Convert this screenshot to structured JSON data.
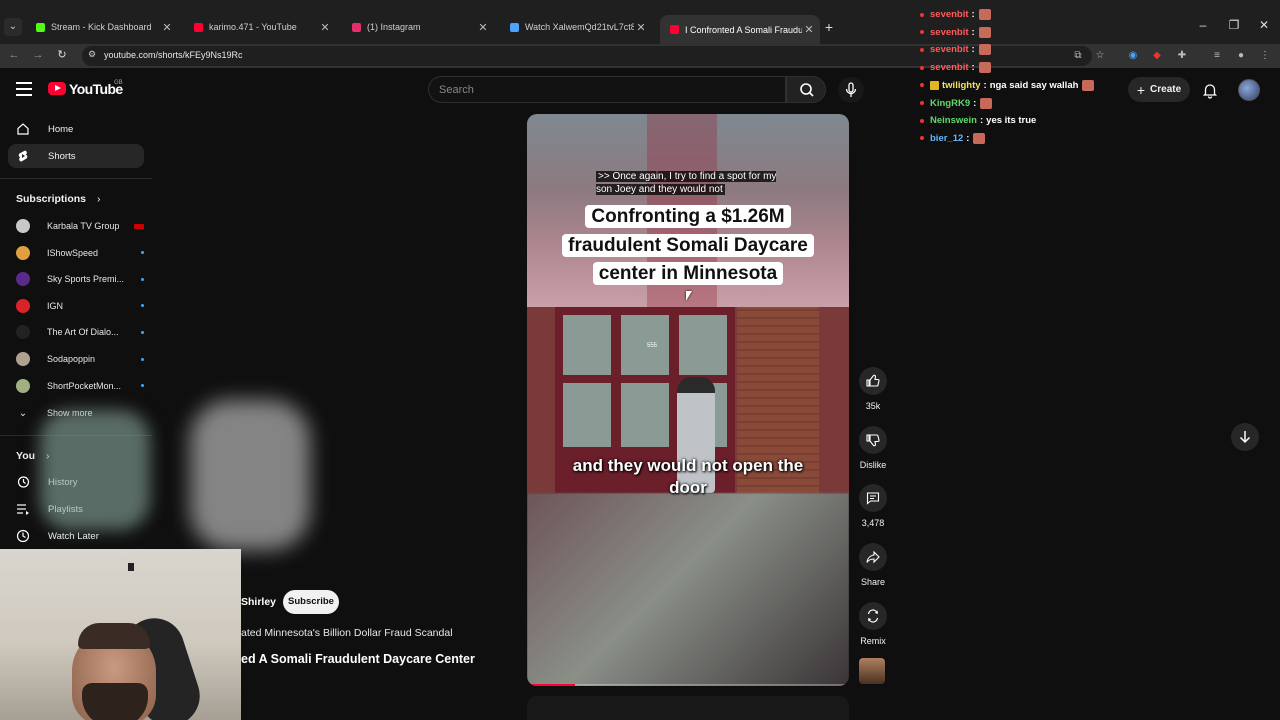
{
  "browser": {
    "tabs": [
      {
        "title": "Stream - Kick Dashboard",
        "color": "#53fc18"
      },
      {
        "title": "karimo.471 - YouTube",
        "color": "#ff0033"
      },
      {
        "title": "(1) Instagram",
        "color": "#e1306c"
      },
      {
        "title": "Watch XalwemQd21tvL7ct8RUt...",
        "color": "#4aa3ff"
      },
      {
        "title": "I Confronted A Somali Fraudule...",
        "color": "#ff0033"
      }
    ],
    "url": "youtube.com/shorts/kFEy9Ns19Rc"
  },
  "masthead": {
    "logo_text": "YouTube",
    "region": "GB",
    "search_placeholder": "Search",
    "create_label": "Create"
  },
  "sidebar": {
    "main": [
      {
        "label": "Home",
        "icon": "home-icon"
      },
      {
        "label": "Shorts",
        "icon": "shorts-icon"
      }
    ],
    "subscriptions_heading": "Subscriptions",
    "channels": [
      {
        "name": "Karbala TV Group",
        "color": "#c8c8c8",
        "live": true
      },
      {
        "name": "IShowSpeed",
        "color": "#e0a040",
        "live": false
      },
      {
        "name": "Sky Sports Premi...",
        "color": "#5a2a8a",
        "live": false
      },
      {
        "name": "IGN",
        "color": "#d8232a",
        "live": false
      },
      {
        "name": "The Art Of Dialo...",
        "color": "#222222",
        "live": false
      },
      {
        "name": "Sodapoppin",
        "color": "#b0a090",
        "live": false
      },
      {
        "name": "ShortPocketMon...",
        "color": "#a0b080",
        "live": false
      }
    ],
    "show_more": "Show more",
    "you_heading": "You",
    "you_items": [
      {
        "label": "History",
        "icon": "history-icon"
      },
      {
        "label": "Playlists",
        "icon": "playlists-icon"
      },
      {
        "label": "Watch Later",
        "icon": "watch-later-icon"
      }
    ]
  },
  "short": {
    "caption_small": ">> Once again, I try to find a spot for my son Joey and they would not",
    "title_card": "Confronting a $1.26M fraudulent Somali Daycare center in Minnesota",
    "subtitle": "and they would not open the door",
    "door_number": "555",
    "progress_fraction": 0.15,
    "channel_handle": "Shirley",
    "subscribe_label": "Subscribe",
    "playlist": "ated Minnesota's Billion Dollar Fraud Scandal",
    "title": "ed A Somali Fraudulent Daycare Center"
  },
  "actions": [
    {
      "label": "35k",
      "icon": "like-icon"
    },
    {
      "label": "Dislike",
      "icon": "dislike-icon"
    },
    {
      "label": "3,478",
      "icon": "comment-icon"
    },
    {
      "label": "Share",
      "icon": "share-icon"
    },
    {
      "label": "Remix",
      "icon": "remix-icon"
    }
  ],
  "chat": [
    {
      "user": "sevenbit",
      "color": "#ff5b5b",
      "msg": "",
      "emote": true,
      "badge": false
    },
    {
      "user": "sevenbit",
      "color": "#ff5b5b",
      "msg": "",
      "emote": true,
      "badge": false
    },
    {
      "user": "sevenbit",
      "color": "#ff5b5b",
      "msg": "",
      "emote": true,
      "badge": false
    },
    {
      "user": "sevenbit",
      "color": "#ff5b5b",
      "msg": "",
      "emote": true,
      "badge": false
    },
    {
      "user": "twilighty",
      "color": "#f5e35b",
      "msg": "nga said say wallah",
      "emote": true,
      "badge": true
    },
    {
      "user": "KingRK9",
      "color": "#62d66b",
      "msg": "",
      "emote": true,
      "badge": false
    },
    {
      "user": "Neinswein",
      "color": "#62d66b",
      "msg": "yes its true",
      "emote": false,
      "badge": false
    },
    {
      "user": "bier_12",
      "color": "#62b6ff",
      "msg": "",
      "emote": true,
      "badge": false
    }
  ]
}
